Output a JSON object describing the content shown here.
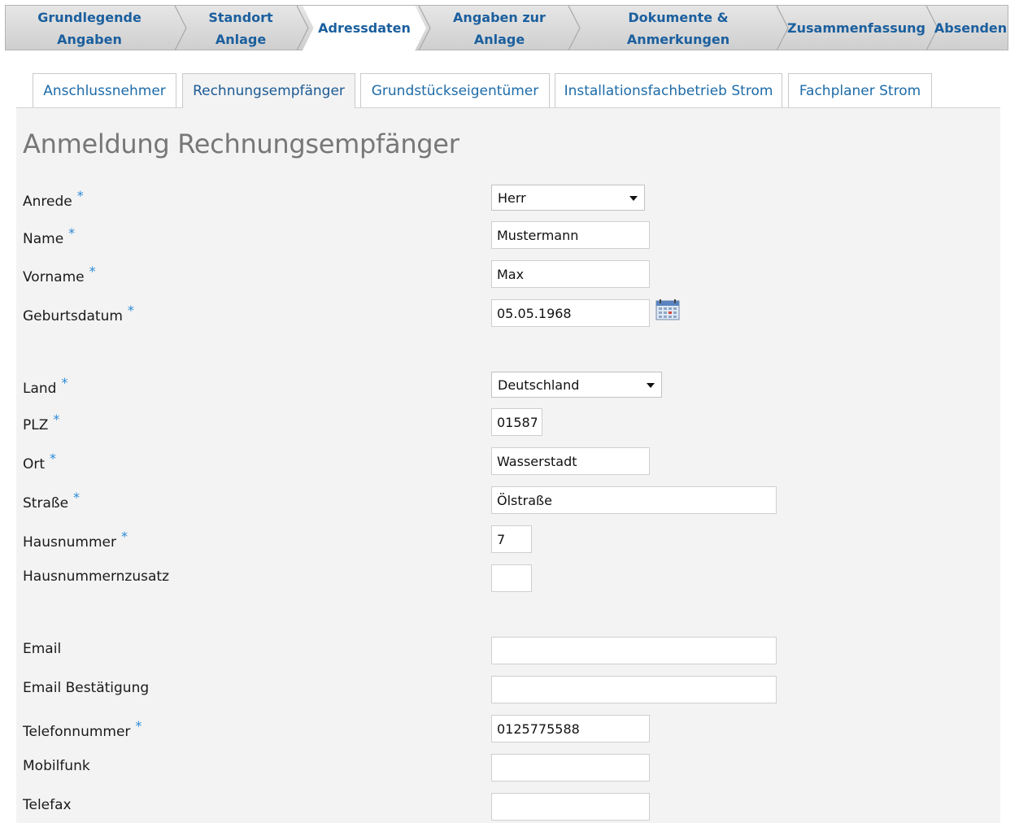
{
  "wizard": {
    "steps": [
      {
        "line1": "Grundlegende",
        "line2": "Angaben"
      },
      {
        "line1": "Standort",
        "line2": "Anlage"
      },
      {
        "line1": "Adressdaten",
        "line2": ""
      },
      {
        "line1": "Angaben zur",
        "line2": "Anlage"
      },
      {
        "line1": "Dokumente &",
        "line2": "Anmerkungen"
      },
      {
        "line1": "Zusammenfassung",
        "line2": ""
      },
      {
        "line1": "Absenden",
        "line2": ""
      }
    ],
    "active_step": "Adressdaten"
  },
  "tabs": {
    "items": [
      {
        "label": "Anschlussnehmer"
      },
      {
        "label": "Rechnungsempfänger"
      },
      {
        "label": "Grundstückseigentümer"
      },
      {
        "label": "Installationsfachbetrieb Strom"
      },
      {
        "label": "Fachplaner Strom"
      }
    ],
    "active_tab": "Rechnungsempfänger"
  },
  "form": {
    "title": "Anmeldung Rechnungsempfänger",
    "required_marker": "*",
    "fields": {
      "anrede": {
        "label": "Anrede",
        "value": "Herr"
      },
      "name": {
        "label": "Name",
        "value": "Mustermann"
      },
      "vorname": {
        "label": "Vorname",
        "value": "Max"
      },
      "geburtsdatum": {
        "label": "Geburtsdatum",
        "value": "05.05.1968"
      },
      "land": {
        "label": "Land",
        "value": "Deutschland"
      },
      "plz": {
        "label": "PLZ",
        "value": "01587"
      },
      "ort": {
        "label": "Ort",
        "value": "Wasserstadt"
      },
      "strasse": {
        "label": "Straße",
        "value": "Ölstraße"
      },
      "hausnummer": {
        "label": "Hausnummer",
        "value": "7"
      },
      "hausnummernzusatz": {
        "label": "Hausnummernzusatz",
        "value": ""
      },
      "email": {
        "label": "Email",
        "value": ""
      },
      "email_bestaetigung": {
        "label": "Email Bestätigung",
        "value": ""
      },
      "telefonnummer": {
        "label": "Telefonnummer",
        "value": "0125775588"
      },
      "mobilfunk": {
        "label": "Mobilfunk",
        "value": ""
      },
      "telefax": {
        "label": "Telefax",
        "value": ""
      }
    }
  },
  "icons": {
    "calendar": "calendar-icon",
    "dropdown": "chevron-down-icon"
  },
  "colors": {
    "accent": "#1d6ba8",
    "required": "#2a8ad8",
    "panel": "#f3f3f3"
  }
}
